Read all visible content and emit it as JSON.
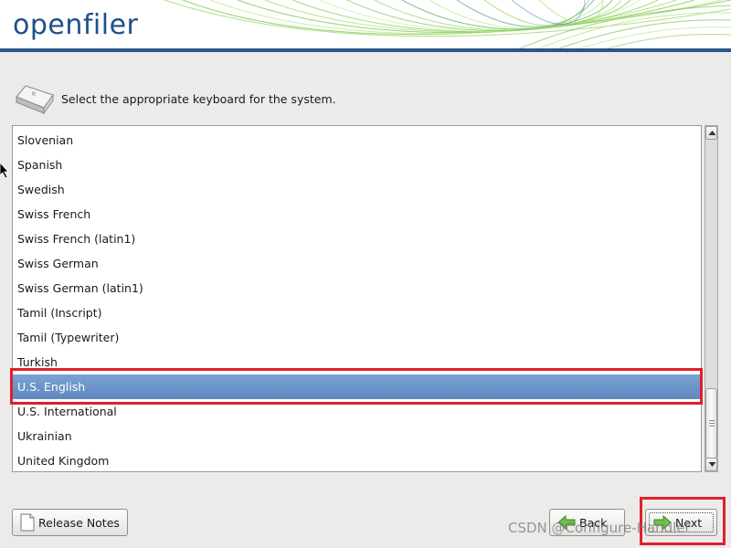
{
  "header": {
    "logo_text": "openfiler"
  },
  "prompt": {
    "text": "Select the appropriate keyboard for the system.",
    "icon": "keyboard-key-icon"
  },
  "keyboard_list": {
    "selected": "U.S. English",
    "items": [
      "Slovenian",
      "Spanish",
      "Swedish",
      "Swiss French",
      "Swiss French (latin1)",
      "Swiss German",
      "Swiss German (latin1)",
      "Tamil (Inscript)",
      "Tamil (Typewriter)",
      "Turkish",
      "U.S. English",
      "U.S. International",
      "Ukrainian",
      "United Kingdom"
    ]
  },
  "buttons": {
    "release_notes": "Release Notes",
    "back": "Back",
    "next": "Next"
  },
  "watermark": {
    "text": "CSDN @Configure-Handler"
  },
  "colors": {
    "header_rule": "#2a5689",
    "selection": "#6e94c9",
    "highlight_box": "#e0202a",
    "logo": "#1f4f8a"
  }
}
